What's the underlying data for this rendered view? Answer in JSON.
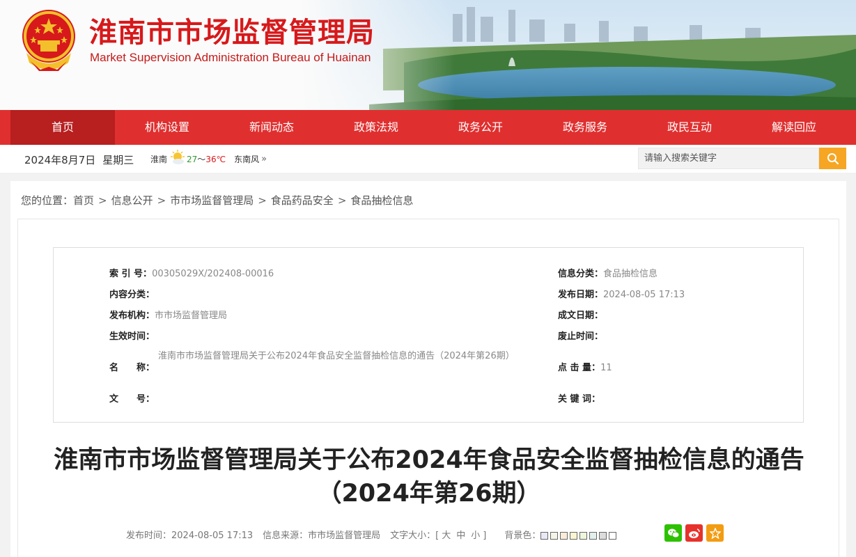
{
  "site": {
    "title": "淮南市市场监督管理局",
    "subtitle": "Market Supervision Administration Bureau of Huainan"
  },
  "nav": {
    "items": [
      "首页",
      "机构设置",
      "新闻动态",
      "政策法规",
      "政务公开",
      "政务服务",
      "政民互动",
      "解读回应"
    ],
    "active_index": 0
  },
  "infobar": {
    "date": "2024年8月7日",
    "weekday": "星期三",
    "city": "淮南",
    "temp_low": "27",
    "temp_sep": "～",
    "temp_high": "36℃",
    "wind": "东南风",
    "more_icon": "»",
    "weather_icon": "sunny-cloud-icon"
  },
  "search": {
    "placeholder": "请输入搜索关键字",
    "icon": "search-icon"
  },
  "breadcrumb": {
    "prefix": "您的位置：",
    "items": [
      "首页",
      "信息公开",
      "市市场监督管理局",
      "食品药品安全",
      "食品抽检信息"
    ],
    "separator": ">"
  },
  "meta": {
    "index_no_label": "索 引 号：",
    "index_no": "00305029X/202408-00016",
    "content_cat_label": "内容分类：",
    "content_cat": "",
    "publisher_label": "发布机构：",
    "publisher": "市市场监督管理局",
    "effective_label": "生效时间：",
    "effective": "",
    "name_label": "名　　称：",
    "name": "淮南市市场监督管理局关于公布2024年食品安全监督抽检信息的通告（2024年第26期）",
    "docno_label": "文　　号：",
    "docno": "",
    "info_cat_label": "信息分类：",
    "info_cat": "食品抽检信息",
    "pub_date_label": "发布日期：",
    "pub_date": "2024-08-05 17:13",
    "written_date_label": "成文日期：",
    "written_date": "",
    "expire_label": "废止时间：",
    "expire": "",
    "clicks_label": "点 击 量：",
    "clicks": "11",
    "keywords_label": "关 键 词：",
    "keywords": ""
  },
  "article": {
    "title": "淮南市市场监督管理局关于公布2024年食品安全监督抽检信息的通告（2024年第26期）",
    "pub_time": "发布时间：2024-08-05 17:13",
    "source": "信息来源：市市场监督管理局",
    "font_size_label": "文字大小：[",
    "font_sizes": [
      "大",
      "中",
      "小"
    ],
    "font_size_close": "]",
    "bg_label": "背景色：",
    "bg_colors": [
      "#e9e9f5",
      "#f5f5e6",
      "#f9ecd9",
      "#fbf5d0",
      "#eef7dc",
      "#e0f0ec",
      "#dcdcdc",
      "#ffffff"
    ],
    "share_icons": [
      "wechat-icon",
      "weibo-icon",
      "favorite-star-icon"
    ]
  },
  "colors": {
    "brand_red": "#d7191b",
    "nav_red": "#e02f2f",
    "nav_active": "#b81f1f",
    "search_orange": "#f6a623",
    "wechat_green": "#2dc100",
    "weibo_red": "#e6322b",
    "star_orange": "#f39c12"
  }
}
